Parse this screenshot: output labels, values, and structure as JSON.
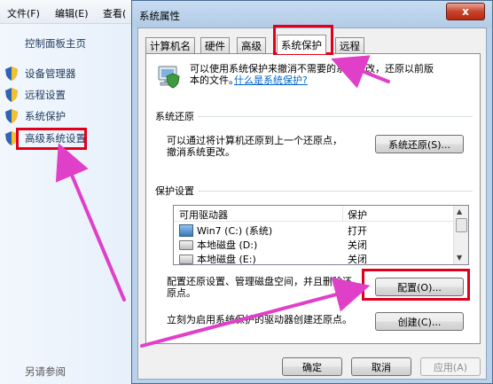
{
  "control_panel": {
    "menu": [
      "文件(F)",
      "编辑(E)",
      "查看("
    ],
    "home": "控制面板主页",
    "links": [
      "设备管理器",
      "远程设置",
      "系统保护",
      "高级系统设置"
    ],
    "see_also": "另请参阅"
  },
  "dialog": {
    "title": "系统属性",
    "close_label": "x",
    "tabs": [
      "计算机名",
      "硬件",
      "高级",
      "系统保护",
      "远程"
    ],
    "active_tab": "系统保护",
    "intro_line1": "可以使用系统保护来撤消不需要的系统更改，还原以前版",
    "intro_line2": "本的文件。",
    "intro_link": "什么是系统保护?",
    "restore": {
      "heading": "系统还原",
      "text_line1": "可以通过将计算机还原到上一个还原点，",
      "text_line2": "撤消系统更改。",
      "button": "系统还原(S)..."
    },
    "protection": {
      "heading": "保护设置",
      "columns": [
        "可用驱动器",
        "保护"
      ],
      "rows": [
        {
          "drive": "Win7 (C:) (系统)",
          "protection": "打开"
        },
        {
          "drive": "本地磁盘 (D:)",
          "protection": "关闭"
        },
        {
          "drive": "本地磁盘 (E:)",
          "protection": "关闭"
        }
      ],
      "configure_text_line1": "配置还原设置、管理磁盘空间，并且删除还",
      "configure_text_line2": "原点。",
      "configure_button": "配置(O)...",
      "create_text": "立刻为启用系统保护的驱动器创建还原点。",
      "create_button": "创建(C)..."
    },
    "footer": {
      "ok": "确定",
      "cancel": "取消",
      "apply": "应用(A)"
    }
  },
  "colors": {
    "highlight": "#e0001b",
    "arrow": "#e040c8",
    "link": "#0066cc"
  }
}
